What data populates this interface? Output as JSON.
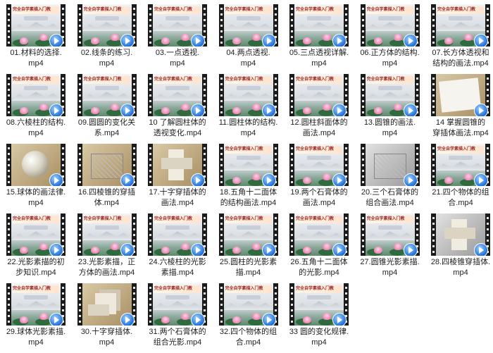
{
  "file_type_icon": "video-play-icon",
  "files": [
    {
      "line1": "01.材料的选择.",
      "line2": "mp4",
      "thumb": "slide"
    },
    {
      "line1": "02.线条的练习.",
      "line2": "mp4",
      "thumb": "slide"
    },
    {
      "line1": "03.一点透视.",
      "line2": "mp4",
      "thumb": "slide"
    },
    {
      "line1": "04.两点透视.",
      "line2": "mp4",
      "thumb": "slide"
    },
    {
      "line1": "05.三点透视详解.",
      "line2": "mp4",
      "thumb": "slide"
    },
    {
      "line1": "06.正方体的结构.",
      "line2": "mp4",
      "thumb": "slide"
    },
    {
      "line1": "07.长方体透视和",
      "line2": "结构的画法.mp4",
      "thumb": "slide"
    },
    {
      "line1": "08.六棱柱的结构.",
      "line2": "mp4",
      "thumb": "slide"
    },
    {
      "line1": "09.圆圆的变化关",
      "line2": "系.mp4",
      "thumb": "slide"
    },
    {
      "line1": "10 了解圆柱体的",
      "line2": "透视变化.mp4",
      "thumb": "slide"
    },
    {
      "line1": "11.圆柱体的结构.",
      "line2": "mp4",
      "thumb": "slide"
    },
    {
      "line1": "12.圆柱斜面体的",
      "line2": "画法.mp4",
      "thumb": "slide"
    },
    {
      "line1": "13.圆锥的画法.",
      "line2": "mp4",
      "thumb": "slide"
    },
    {
      "line1": "14  掌握圆锥的",
      "line2": "穿插体画法.mp4",
      "thumb": "paper"
    },
    {
      "line1": "15.球体的画法律.",
      "line2": "mp4",
      "thumb": "sphere"
    },
    {
      "line1": "16.四棱锥的穿插",
      "line2": "体.mp4",
      "thumb": "sketch"
    },
    {
      "line1": "17.十字穿插体的",
      "line2": "画法.mp4",
      "thumb": "cross"
    },
    {
      "line1": "18.五角十二面体",
      "line2": "的结构画法.mp4",
      "thumb": "slide"
    },
    {
      "line1": "19.两个石膏体的",
      "line2": "画法.mp4",
      "thumb": "slide"
    },
    {
      "line1": "20.三个石膏体的",
      "line2": "组合画法.mp4",
      "thumb": "sketch-gray"
    },
    {
      "line1": "21.四个物体的组",
      "line2": "合.mp4",
      "thumb": "slide"
    },
    {
      "line1": "22.光影素描的初",
      "line2": "步知识.mp4",
      "thumb": "slide"
    },
    {
      "line1": "23.光影素描，正",
      "line2": "方体的画法.mp4",
      "thumb": "slide"
    },
    {
      "line1": "24.六棱柱的光影",
      "line2": "素描.mp4",
      "thumb": "slide"
    },
    {
      "line1": "25.圆柱的光影素",
      "line2": "描.mp4",
      "thumb": "slide"
    },
    {
      "line1": "26.五角十二面体",
      "line2": "的光影.mp4",
      "thumb": "slide"
    },
    {
      "line1": "27.圆锥光影素描.",
      "line2": "mp4",
      "thumb": "slide"
    },
    {
      "line1": "28.四棱锥穿插体.",
      "line2": "mp4",
      "thumb": "cross-gray"
    },
    {
      "line1": "29.球体光影素描.",
      "line2": "mp4",
      "thumb": "slide"
    },
    {
      "line1": "30.十字穿插体.",
      "line2": "mp4",
      "thumb": "cube"
    },
    {
      "line1": "31.两个石膏体的",
      "line2": "组合光影.mp4",
      "thumb": "slide"
    },
    {
      "line1": "32.四个物体的组",
      "line2": "合.mp4",
      "thumb": "slide"
    },
    {
      "line1": "33 圆的变化规律.",
      "line2": "mp4",
      "thumb": "slide"
    }
  ],
  "slide_title_text": "完全自学素描入门教"
}
